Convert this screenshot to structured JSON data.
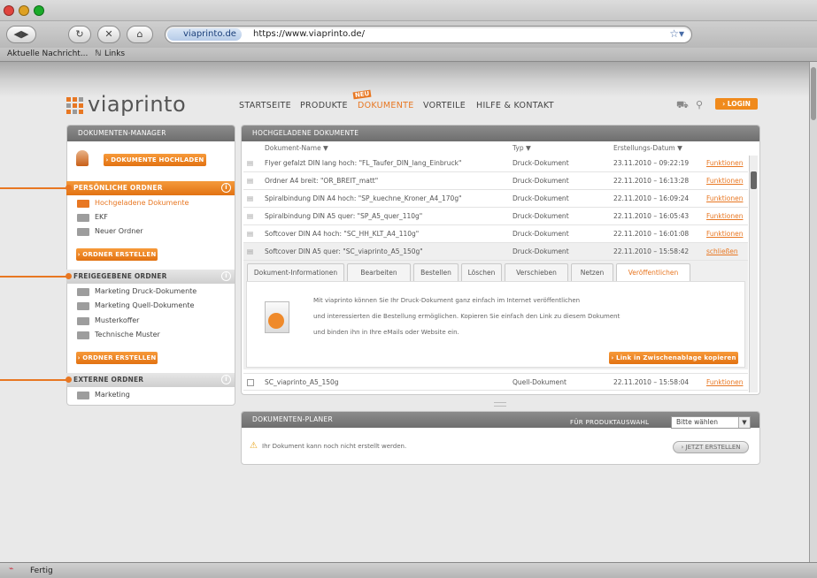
{
  "browser": {
    "url_tag": "viaprinto.de",
    "url": "https://www.viaprinto.de/",
    "bookmarks": [
      "Aktuelle Nachricht...",
      "Links"
    ],
    "status": "Fertig"
  },
  "site": {
    "logo": "viaprinto",
    "nav": [
      "STARTSEITE",
      "PRODUKTE",
      "DOKUMENTE",
      "VORTEILE",
      "HILFE & KONTAKT"
    ],
    "nav_badge": "NEU",
    "login": "› LOGIN"
  },
  "left": {
    "header": "DOKUMENTEN-MANAGER",
    "upload_button": "› DOKUMENTE HOCHLADEN",
    "personal": {
      "title": "PERSÖNLICHE ORDNER",
      "folders": [
        "Hochgeladene Dokumente",
        "EKF",
        "Neuer Ordner"
      ],
      "create": "› ORDNER ERSTELLEN"
    },
    "shared": {
      "title": "FREIGEGEBENE ORDNER",
      "folders": [
        "Marketing Druck-Dokumente",
        "Marketing Quell-Dokumente",
        "Musterkoffer",
        "Technische Muster"
      ],
      "create": "› ORDNER ERSTELLEN"
    },
    "external": {
      "title": "EXTERNE ORDNER",
      "folders": [
        "Marketing"
      ]
    }
  },
  "docs": {
    "header": "HOCHGELADENE DOKUMENTE",
    "columns": [
      "Dokument-Name ▼",
      "Typ ▼",
      "Erstellungs-Datum ▼"
    ],
    "rows": [
      {
        "name": "Flyer gefalzt DIN lang hoch: \"FL_Taufer_DIN_lang_Einbruck\"",
        "type": "Druck-Dokument",
        "date": "23.11.2010 – 09:22:19",
        "action": "Funktionen"
      },
      {
        "name": "Ordner A4 breit: \"OR_BREIT_matt\"",
        "type": "Druck-Dokument",
        "date": "22.11.2010 – 16:13:28",
        "action": "Funktionen"
      },
      {
        "name": "Spiralbindung DIN A4 hoch: \"SP_kuechne_Kroner_A4_170g\"",
        "type": "Druck-Dokument",
        "date": "22.11.2010 – 16:09:24",
        "action": "Funktionen"
      },
      {
        "name": "Spiralbindung DIN A5 quer: \"SP_A5_quer_110g\"",
        "type": "Druck-Dokument",
        "date": "22.11.2010 – 16:05:43",
        "action": "Funktionen"
      },
      {
        "name": "Softcover DIN A4 hoch: \"SC_HH_KLT_A4_110g\"",
        "type": "Druck-Dokument",
        "date": "22.11.2010 – 16:01:08",
        "action": "Funktionen"
      },
      {
        "name": "Softcover DIN A5 quer: \"SC_viaprinto_A5_150g\"",
        "type": "Druck-Dokument",
        "date": "22.11.2010 – 15:58:42",
        "action": "schließen"
      }
    ],
    "tabs": [
      "Dokument-Informationen",
      "Bearbeiten",
      "Bestellen",
      "Löschen",
      "Verschieben",
      "Netzen",
      "Veröffentlichen"
    ],
    "publish_text": [
      "Mit viaprinto können Sie Ihr Druck-Dokument ganz einfach im Internet veröffentlichen",
      "und interessierten die Bestellung ermöglichen. Kopieren Sie einfach den Link zu diesem Dokument",
      "und binden ihn in Ihre eMails oder Website ein."
    ],
    "copy_link": "› Link in Zwischenablage kopieren",
    "last_row": {
      "name": "SC_viaprinto_A5_150g",
      "type": "Quell-Dokument",
      "date": "22.11.2010 – 15:58:04",
      "action": "Funktionen"
    }
  },
  "planner": {
    "header": "DOKUMENTEN-PLANER",
    "select_label": "FÜR PRODUKTAUSWAHL",
    "select_value": "Bitte wählen",
    "message": "Ihr Dokument kann noch nicht erstellt werden.",
    "button": "› JETZT ERSTELLEN"
  }
}
